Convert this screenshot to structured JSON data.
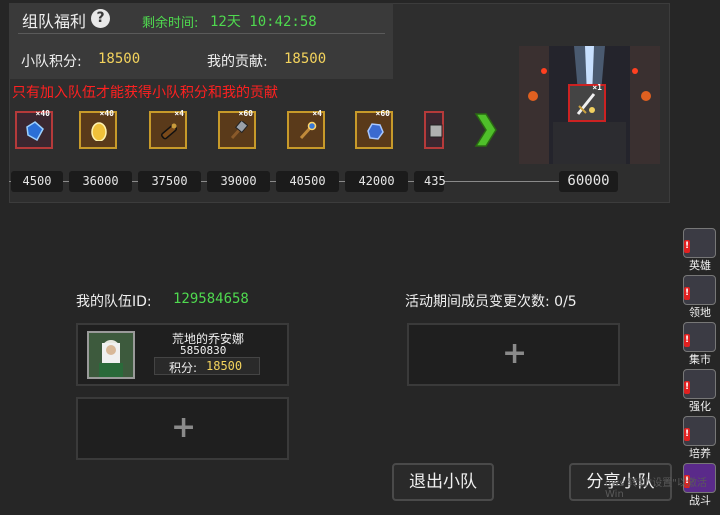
{
  "header": {
    "title": "组队福利",
    "help_icon": "?",
    "timer_label": "剩余时间:",
    "timer_value": "12天 10:42:58",
    "team_points_label": "小队积分:",
    "team_points_value": "18500",
    "contribution_label": "我的贡献:",
    "contribution_value": "18500"
  },
  "warning": "只有加入队伍才能获得小队积分和我的贡献",
  "rewards": [
    {
      "count": "×40",
      "icon": "blue-crystal-icon"
    },
    {
      "count": "×40",
      "icon": "golden-egg-icon"
    },
    {
      "count": "×4",
      "icon": "scroll-icon"
    },
    {
      "count": "×60",
      "icon": "hammer-icon"
    },
    {
      "count": "×4",
      "icon": "magic-staff-icon"
    },
    {
      "count": "×60",
      "icon": "blue-ore-icon"
    },
    {
      "count": "",
      "icon": "armor-piece-icon"
    }
  ],
  "thresholds": [
    "4500",
    "36000",
    "37500",
    "39000",
    "40500",
    "42000",
    "435",
    "60000"
  ],
  "boss_reward": {
    "count": "×1",
    "icon": "sword-icon"
  },
  "team": {
    "id_label": "我的队伍ID:",
    "id_value": "129584658",
    "change_label": "活动期间成员变更次数:",
    "change_value": "0/5",
    "member": {
      "name": "荒地的乔安娜",
      "id": "5850830",
      "points_label": "积分:",
      "points_value": "18500"
    },
    "add_symbol": "+"
  },
  "buttons": {
    "leave": "退出小队",
    "share": "分享小队"
  },
  "side_menu": [
    {
      "label": "英雄",
      "icon": "hero-icon"
    },
    {
      "label": "领地",
      "icon": "territory-icon"
    },
    {
      "label": "集市",
      "icon": "market-icon"
    },
    {
      "label": "强化",
      "icon": "enhance-icon"
    },
    {
      "label": "培养",
      "icon": "cultivate-icon"
    },
    {
      "label": "战斗",
      "icon": "battle-icon"
    }
  ],
  "watermark": "ows\n转到\"设置\"以激活 Win"
}
